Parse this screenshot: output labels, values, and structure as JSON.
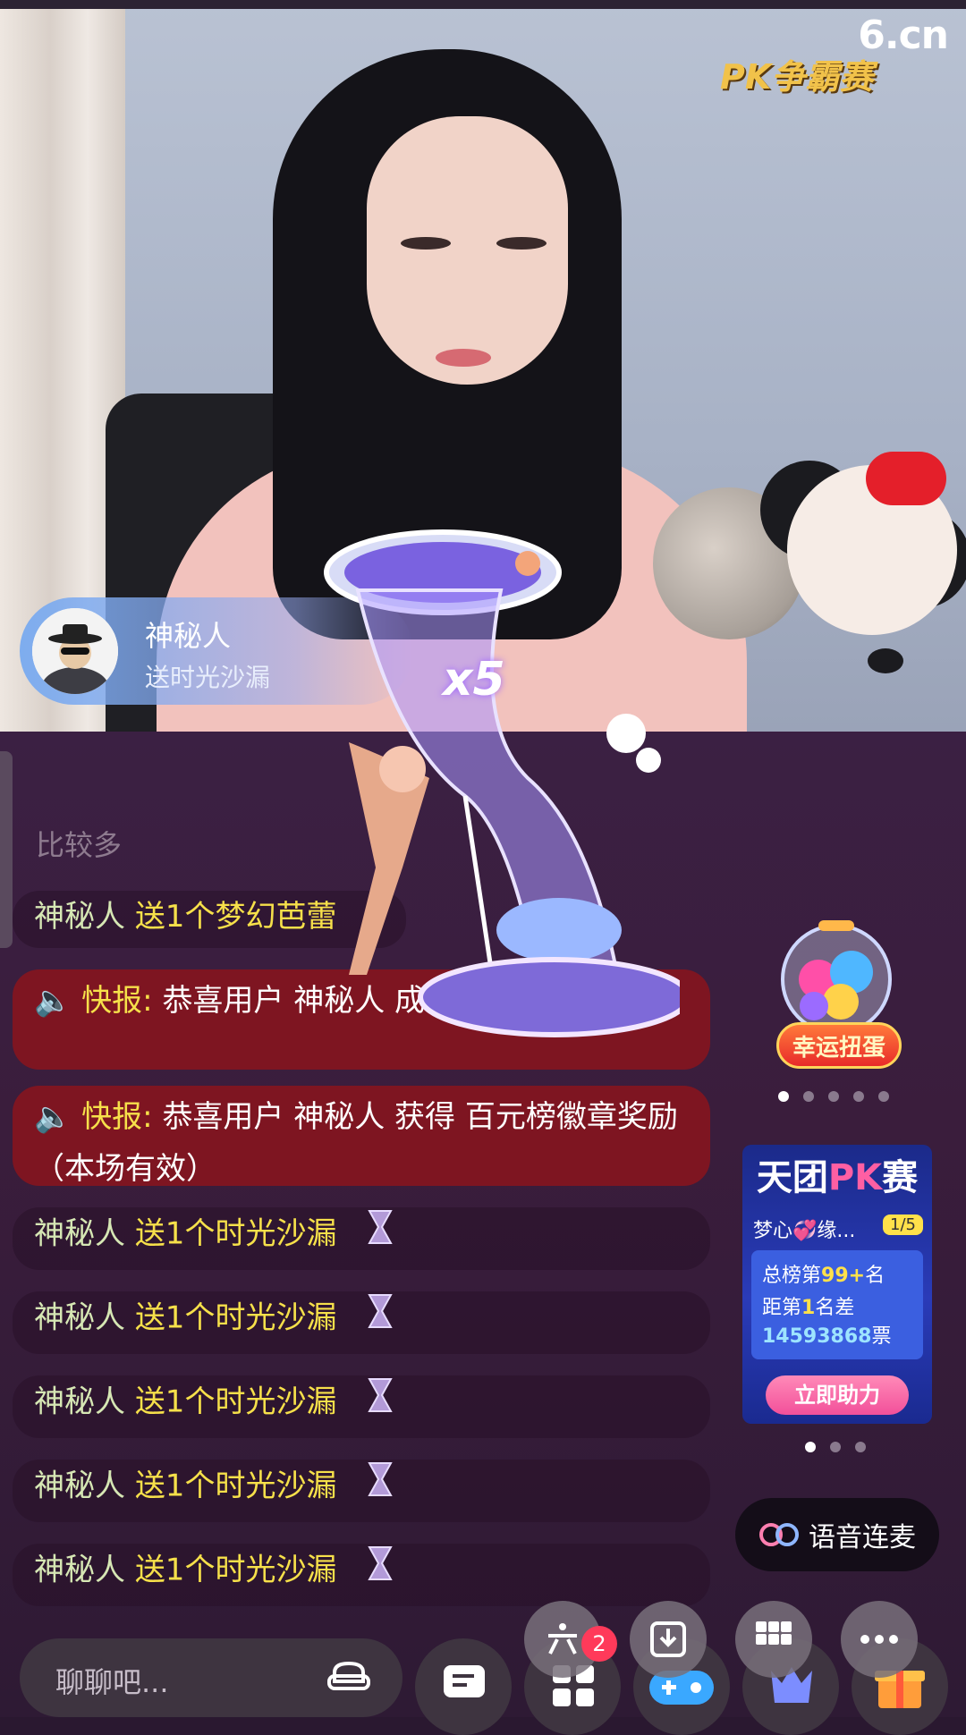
{
  "stream": {
    "site_logo": "6.cn",
    "pk_badge": "PK争霸赛"
  },
  "gift_banner": {
    "user": "神秘人",
    "desc": "送时光沙漏",
    "count": "x5"
  },
  "chat": {
    "faded_line": "比较多",
    "messages": [
      {
        "user": "神秘人",
        "text": "送1个梦幻芭蕾"
      },
      {
        "type": "news",
        "label": "快报:",
        "text": "恭喜用户 神秘人 成为 粉丝团粉丝啦！"
      },
      {
        "type": "news",
        "label": "快报:",
        "text": "恭喜用户 神秘人 获得 百元榜徽章奖励（本场有效）"
      },
      {
        "user": "神秘人",
        "text": "送1个时光沙漏"
      },
      {
        "user": "神秘人",
        "text": "送1个时光沙漏"
      },
      {
        "user": "神秘人",
        "text": "送1个时光沙漏"
      },
      {
        "user": "神秘人",
        "text": "送1个时光沙漏"
      },
      {
        "user": "神秘人",
        "text": "送1个时光沙漏"
      }
    ]
  },
  "gacha": {
    "button_label": "幸运扭蛋",
    "dots_total": 5,
    "dots_active": 0
  },
  "pk_card": {
    "title_a": "天团",
    "title_pk": "PK",
    "title_b": "赛",
    "team": "梦心💞缘...",
    "page": "1/5",
    "rank_prefix": "总榜第",
    "rank_value": "99+",
    "rank_suffix": "名",
    "gap_prefix": "距第",
    "gap_rank": "1",
    "gap_suffix": "名差",
    "votes": "14593868",
    "votes_unit": "票",
    "help_button": "立即助力",
    "dots_total": 3,
    "dots_active": 0
  },
  "voice_button": "语音连麦",
  "bottom_bar": {
    "input_placeholder": "聊聊吧...",
    "badge_count": "2"
  },
  "colors": {
    "accent_pink": "#ff5fa3",
    "gift_yellow": "#f6e04a",
    "news_red": "#87141e"
  }
}
